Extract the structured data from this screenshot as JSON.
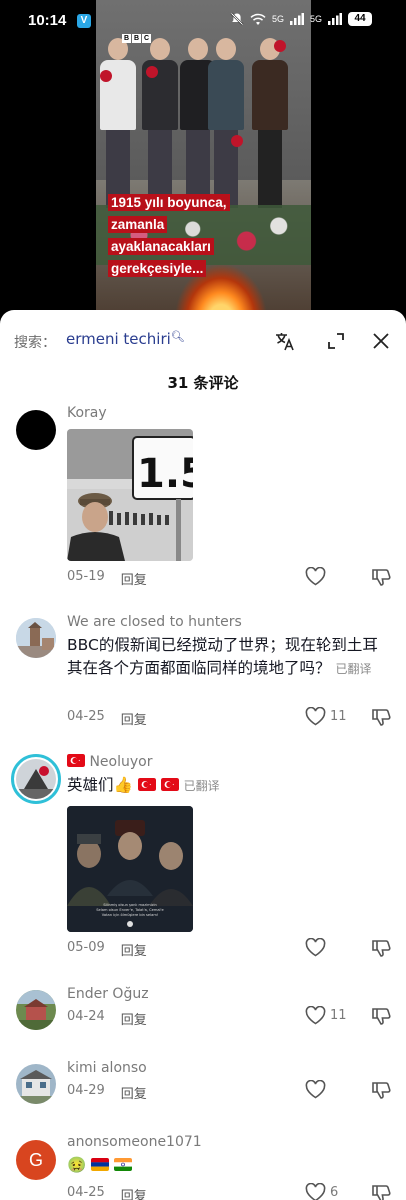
{
  "status_bar": {
    "time": "10:14",
    "app_badge": "V",
    "net1": "5G",
    "net2": "5G",
    "battery": "44"
  },
  "video": {
    "logo": [
      "B",
      "B",
      "C"
    ],
    "caption_lines": [
      "1915 yılı boyunca,",
      "zamanla",
      "ayaklanacakları",
      "gerekçesiyle..."
    ]
  },
  "search": {
    "label": "搜索：",
    "term": "ermeni techiri"
  },
  "comments_header": "31 条评论",
  "comments": [
    {
      "username": "Koray",
      "date": "05-19",
      "reply": "回复",
      "likes": ""
    },
    {
      "username": "We are closed to hunters",
      "text": "BBC的假新闻已经搅动了世界；现在轮到土耳其在各个方面都面临同样的境地了吗？",
      "translated": "已翻译",
      "date": "04-25",
      "reply": "回复",
      "likes": "11"
    },
    {
      "username": "Neoluyor",
      "text": "英雄们👍",
      "translated": "已翻译",
      "date": "05-09",
      "reply": "回复",
      "likes": ""
    },
    {
      "username": "Ender Oğuz",
      "date": "04-24",
      "reply": "回复",
      "likes": "11"
    },
    {
      "username": "kimi alonso",
      "date": "04-29",
      "reply": "回复",
      "likes": ""
    },
    {
      "username": "anonsomeone1071",
      "avatar_letter": "G",
      "text": "🤢",
      "date": "04-25",
      "reply": "回复",
      "likes": "6"
    }
  ],
  "image_sign": "1.5",
  "image_caption_lines": [
    "Silinmiş olsun şanlı mazimizin",
    "Selam olsun Enver'e, Talat'a, Cemal'e",
    "Vatan için ölmüşlere bin selam!"
  ],
  "colors": {
    "accent_link": "#2a3d8f",
    "turkey_red": "#e30a17",
    "caption_bg": "#b8101a"
  }
}
